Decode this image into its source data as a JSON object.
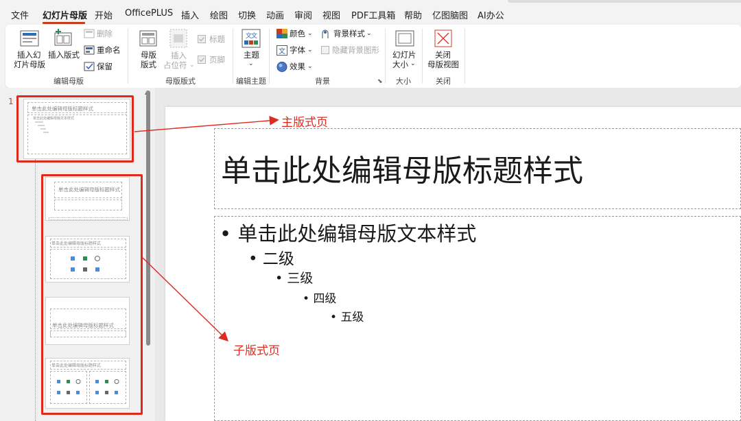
{
  "menu": {
    "items": [
      "文件",
      "幻灯片母版",
      "开始",
      "OfficePLUS",
      "插入",
      "绘图",
      "切换",
      "动画",
      "审阅",
      "视图",
      "PDF工具箱",
      "帮助",
      "亿图脑图",
      "AI办公"
    ]
  },
  "ribbon": {
    "edit_master": {
      "label": "编辑母版",
      "insert_master_l1": "插入幻",
      "insert_master_l2": "灯片母版",
      "insert_layout": "插入版式",
      "delete": "删除",
      "rename": "重命名",
      "preserve": "保留"
    },
    "master_layout": {
      "label": "母版版式",
      "master_layout_l1": "母版",
      "master_layout_l2": "版式",
      "insert_ph_l1": "插入",
      "insert_ph_l2": "占位符",
      "title_check": "标题",
      "footer_check": "页脚"
    },
    "edit_theme": {
      "label": "编辑主题",
      "themes": "主题"
    },
    "background": {
      "label": "背景",
      "colors": "颜色",
      "fonts": "字体",
      "effects": "效果",
      "bg_styles": "背景样式",
      "hide_bg": "隐藏背景图形"
    },
    "size": {
      "label": "大小",
      "slide_size_l1": "幻灯片",
      "slide_size_l2": "大小"
    },
    "close": {
      "label": "关闭",
      "close_l1": "关闭",
      "close_l2": "母版视图"
    }
  },
  "thumbnails": {
    "slide_number": "1",
    "master_title": "单击此处编辑母版标题样式",
    "master_body": "单击此处编辑母版文本样式",
    "layout_title": "单击此处编辑母版标题样式"
  },
  "slide": {
    "title": "单击此处编辑母版标题样式",
    "levels": [
      "单击此处编辑母版文本样式",
      "二级",
      "三级",
      "四级",
      "五级"
    ]
  },
  "annotations": {
    "master_label": "主版式页",
    "child_label": "子版式页",
    "color": "#e02a1f"
  }
}
